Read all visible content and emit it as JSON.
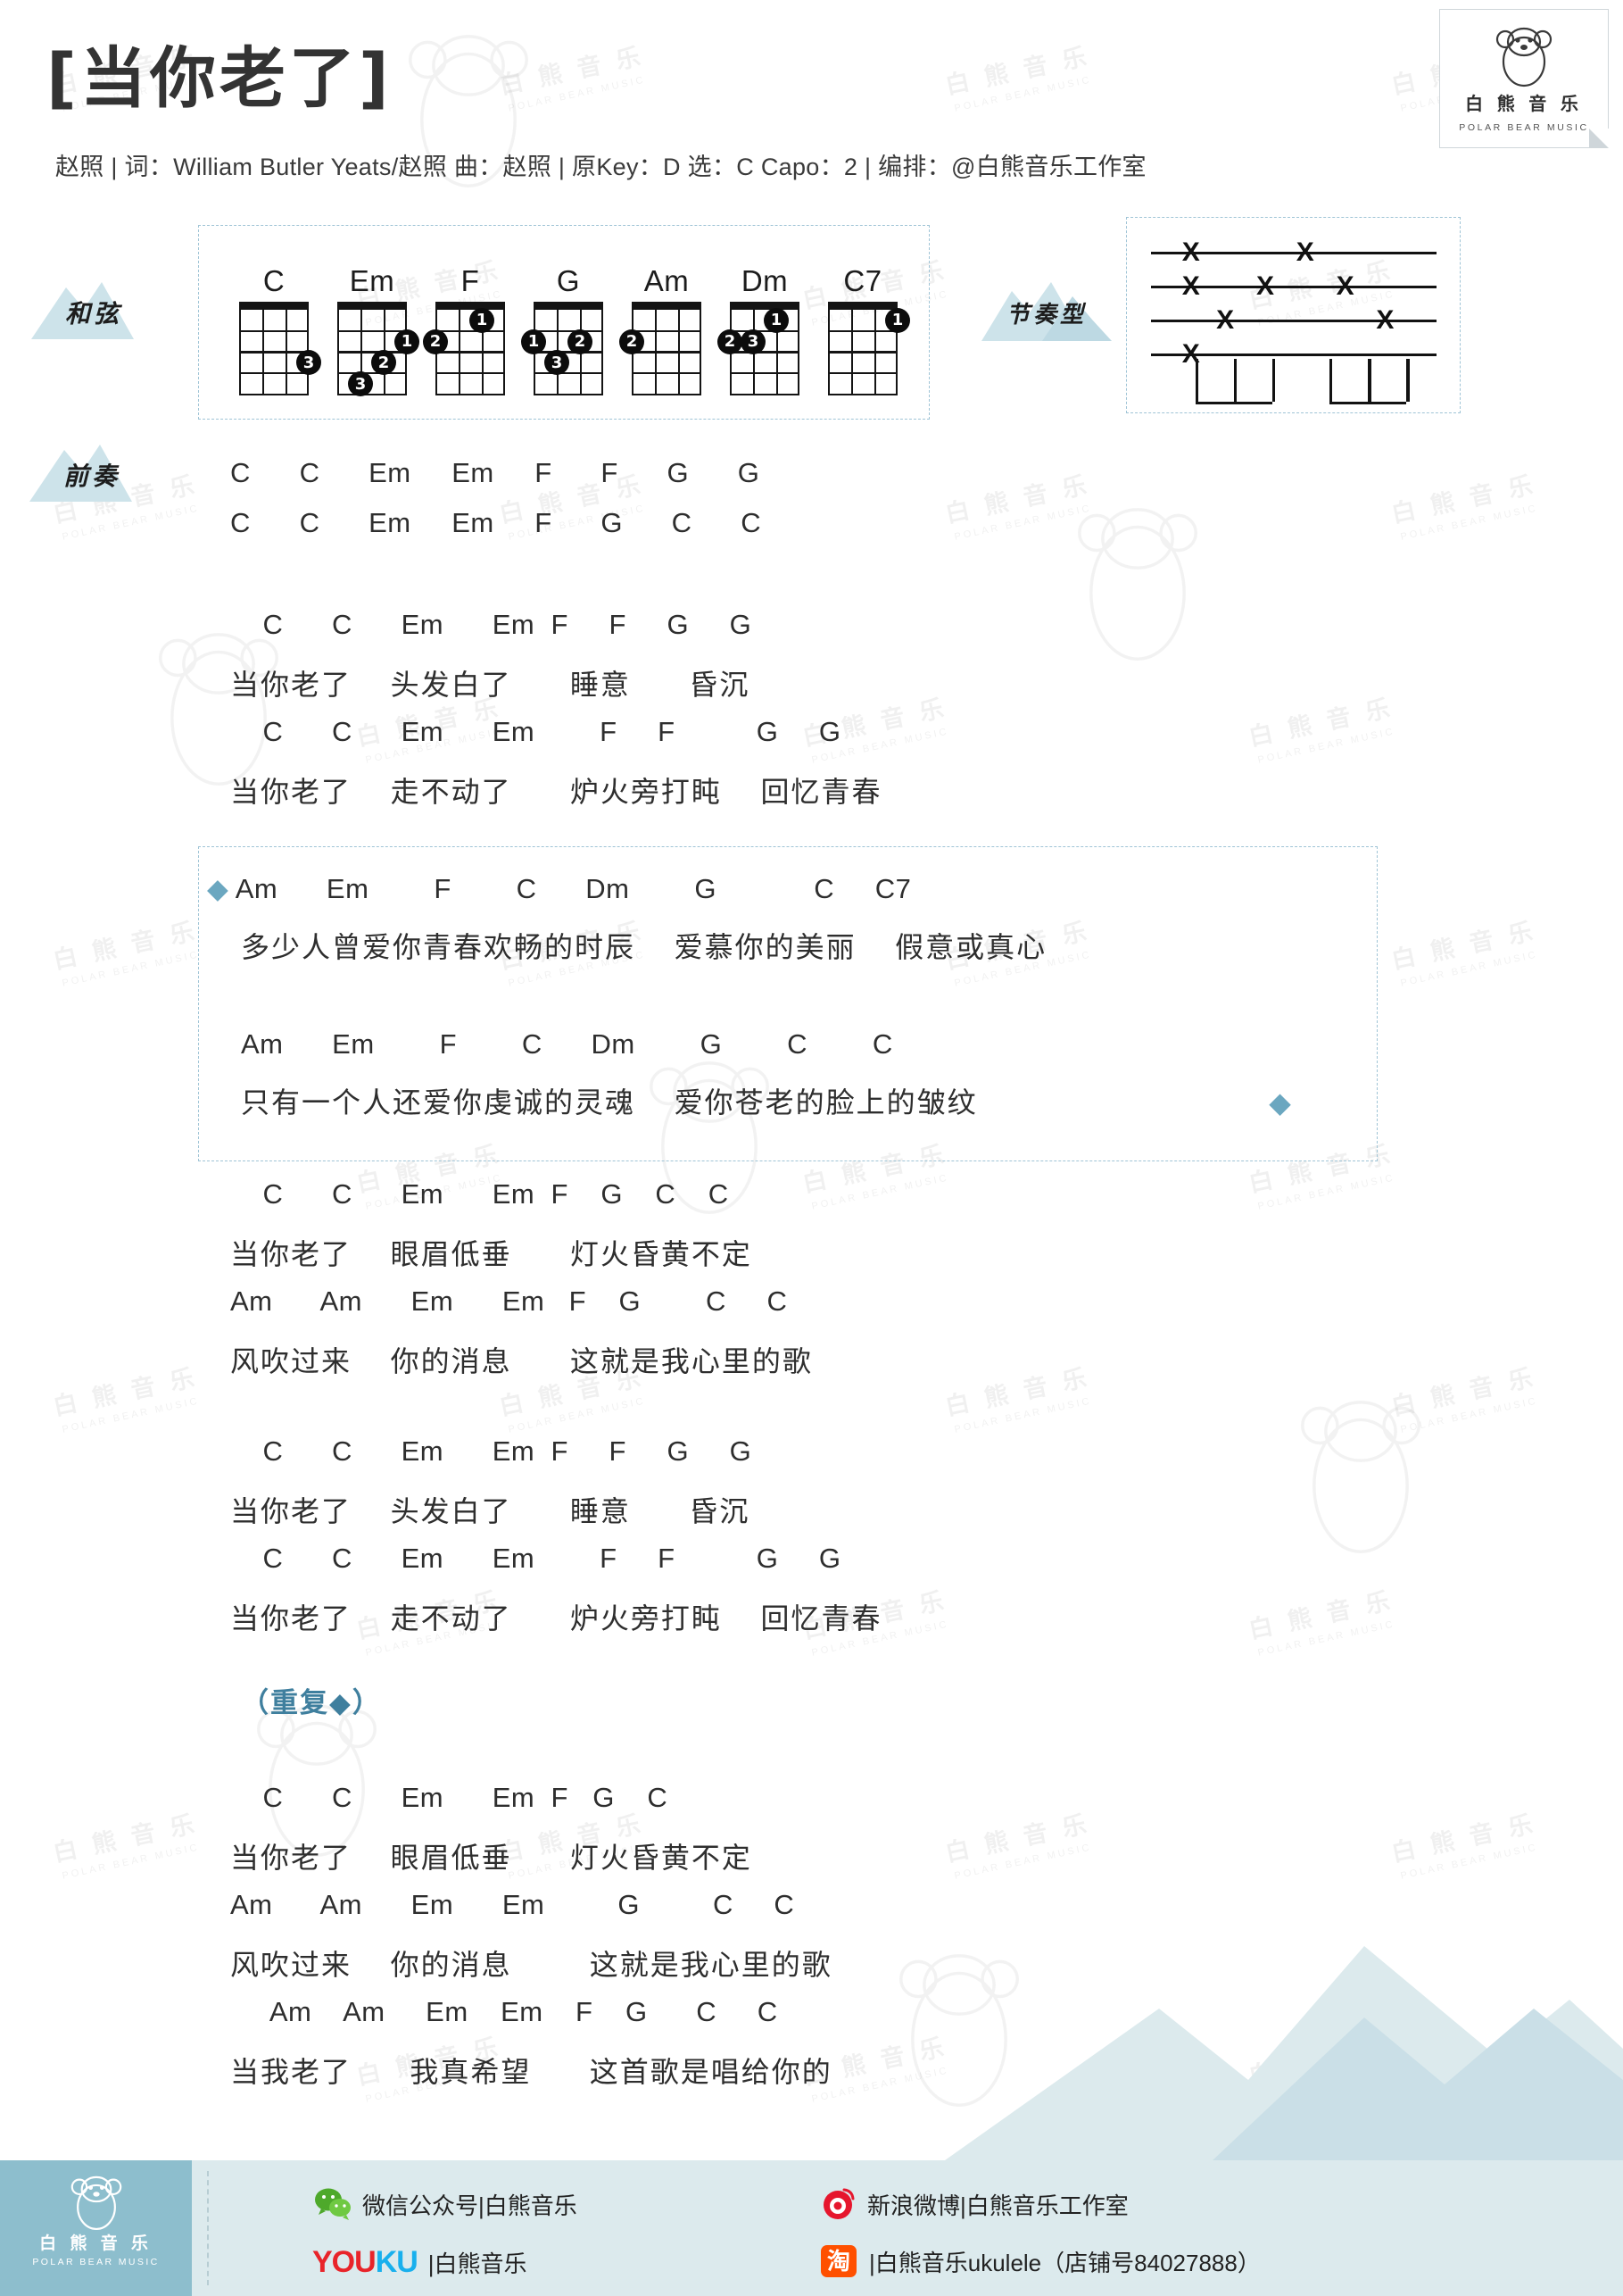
{
  "document": {
    "title": "[当你老了]",
    "meta": "赵照 | 词：William Butler Yeats/赵照 曲：赵照 | 原Key：D  选：C  Capo：2 | 编排：@白熊音乐工作室"
  },
  "brand": {
    "name_cn": "白 熊 音 乐",
    "name_en": "POLAR BEAR MUSIC",
    "icon": "polar-bear-icon"
  },
  "tags": {
    "chords": "和弦",
    "rhythm": "节奏型",
    "intro": "前奏"
  },
  "chords": [
    {
      "name": "C",
      "dots": [
        {
          "string": 4,
          "fret": 3,
          "finger": "3"
        }
      ]
    },
    {
      "name": "Em",
      "dots": [
        {
          "string": 4,
          "fret": 2,
          "finger": "1"
        },
        {
          "string": 3,
          "fret": 3,
          "finger": "2"
        },
        {
          "string": 2,
          "fret": 4,
          "finger": "3"
        }
      ]
    },
    {
      "name": "F",
      "dots": [
        {
          "string": 3,
          "fret": 1,
          "finger": "1"
        },
        {
          "string": 1,
          "fret": 2,
          "finger": "2"
        }
      ]
    },
    {
      "name": "G",
      "dots": [
        {
          "string": 1,
          "fret": 2,
          "finger": "1"
        },
        {
          "string": 3,
          "fret": 2,
          "finger": "2"
        },
        {
          "string": 2,
          "fret": 3,
          "finger": "3"
        }
      ]
    },
    {
      "name": "Am",
      "dots": [
        {
          "string": 1,
          "fret": 2,
          "finger": "2"
        }
      ]
    },
    {
      "name": "Dm",
      "dots": [
        {
          "string": 3,
          "fret": 1,
          "finger": "1"
        },
        {
          "string": 1,
          "fret": 2,
          "finger": "2"
        },
        {
          "string": 2,
          "fret": 2,
          "finger": "3"
        }
      ]
    },
    {
      "name": "C7",
      "dots": [
        {
          "string": 4,
          "fret": 1,
          "finger": "1"
        }
      ]
    }
  ],
  "rhythm_pattern": {
    "strings": 4,
    "marks": [
      {
        "line": 1,
        "positions": [
          0.14,
          0.54
        ]
      },
      {
        "line": 2,
        "positions": [
          0.14,
          0.4,
          0.68
        ]
      },
      {
        "line": 3,
        "positions": [
          0.26,
          0.82
        ]
      },
      {
        "line": 4,
        "positions": [
          0.14
        ]
      }
    ],
    "beams": [
      {
        "start": 0.155,
        "end": 0.425,
        "stems": [
          0.155,
          0.29,
          0.425
        ]
      },
      {
        "start": 0.625,
        "end": 0.895,
        "stems": [
          0.625,
          0.76,
          0.895
        ]
      }
    ]
  },
  "sections": [
    {
      "id": "intro",
      "lines": [
        {
          "type": "chord",
          "text": "C      C      Em     Em     F      F      G      G"
        },
        {
          "type": "chord",
          "text": "C      C      Em     Em     F      G      C      C"
        }
      ]
    },
    {
      "id": "verse1",
      "lines": [
        {
          "type": "chord",
          "text": "    C      C      Em      Em  F     F     G     G"
        },
        {
          "type": "lyric",
          "text": "当你老了    头发白了      睡意      昏沉"
        },
        {
          "type": "chord",
          "text": "    C      C      Em      Em        F     F          G     G"
        },
        {
          "type": "lyric",
          "text": "当你老了    走不动了      炉火旁打盹    回忆青春"
        }
      ]
    },
    {
      "id": "chorus",
      "boxed": true,
      "lines": [
        {
          "type": "chord",
          "text": "Am      Em        F        C      Dm        G            C     C7",
          "diamond_left": true
        },
        {
          "type": "lyric",
          "text": "多少人曾爱你青春欢畅的时辰    爱慕你的美丽    假意或真心"
        },
        {
          "type": "spacer"
        },
        {
          "type": "chord",
          "text": "Am      Em        F        C      Dm        G        C        C"
        },
        {
          "type": "lyric",
          "text": "只有一个人还爱你虔诚的灵魂    爱你苍老的脸上的皱纹",
          "diamond_right": true
        }
      ]
    },
    {
      "id": "verse2",
      "lines": [
        {
          "type": "chord",
          "text": "    C      C      Em      Em  F    G    C    C"
        },
        {
          "type": "lyric",
          "text": "当你老了    眼眉低垂      灯火昏黄不定"
        },
        {
          "type": "chord",
          "text": "Am      Am      Em      Em   F    G        C     C"
        },
        {
          "type": "lyric",
          "text": "风吹过来    你的消息      这就是我心里的歌"
        }
      ]
    },
    {
      "id": "verse3",
      "lines": [
        {
          "type": "chord",
          "text": "    C      C      Em      Em  F     F     G     G"
        },
        {
          "type": "lyric",
          "text": "当你老了    头发白了      睡意      昏沉"
        },
        {
          "type": "chord",
          "text": "    C      C      Em      Em        F     F          G     G"
        },
        {
          "type": "lyric",
          "text": "当你老了    走不动了      炉火旁打盹    回忆青春"
        }
      ]
    },
    {
      "id": "repeat",
      "label": "（重复◆）"
    },
    {
      "id": "verse4",
      "lines": [
        {
          "type": "chord",
          "text": "    C      C      Em      Em  F   G    C"
        },
        {
          "type": "lyric",
          "text": "当你老了    眼眉低垂      灯火昏黄不定"
        },
        {
          "type": "chord",
          "text": "Am      Am      Em      Em         G         C     C"
        },
        {
          "type": "lyric",
          "text": "风吹过来    你的消息        这就是我心里的歌"
        },
        {
          "type": "chord",
          "text": "     Am    Am     Em    Em    F    G      C     C"
        },
        {
          "type": "lyric",
          "text": "当我老了      我真希望      这首歌是唱给你的"
        }
      ]
    }
  ],
  "footer": {
    "brand_cn": "白 熊 音 乐",
    "brand_en": "POLAR BEAR MUSIC",
    "items": [
      {
        "icon": "wechat-icon",
        "label": "微信公众号|白熊音乐"
      },
      {
        "icon": "weibo-icon",
        "label": "新浪微博|白熊音乐工作室"
      },
      {
        "icon": "youku-icon",
        "label": "|白熊音乐",
        "brand": "YOUKU"
      },
      {
        "icon": "taobao-icon",
        "label": "|白熊音乐ukulele（店铺号84027888）"
      }
    ]
  },
  "colors": {
    "accent_blue": "#6ba7c0",
    "mountain": "#cde3ea",
    "footer_left": "#8dbecd",
    "footer_right": "#dceaed",
    "dash_border": "#9fc4d6"
  },
  "watermark": {
    "cn": "白 熊 音 乐",
    "en": "POLAR BEAR MUSIC"
  }
}
